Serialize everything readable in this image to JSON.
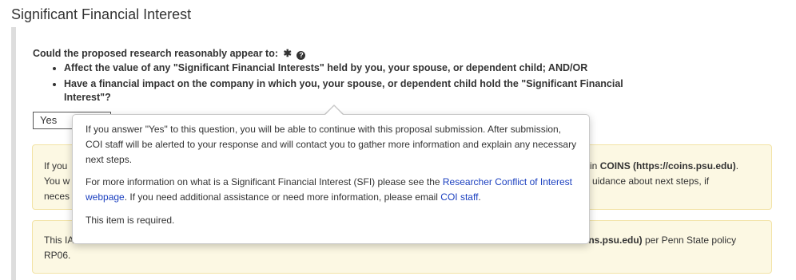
{
  "section": {
    "title": "Significant Financial Interest"
  },
  "question": {
    "label": "Could the proposed research reasonably appear to:",
    "required_icon": "asterisk-icon",
    "help_icon": "question-circle-icon",
    "bullets": [
      "Affect the value of any \"Significant Financial Interests\" held by you, your spouse, or dependent child; AND/OR",
      "Have a financial impact on the company in which you, your spouse, or dependent child hold the \"Significant Financial Interest\"?"
    ]
  },
  "answer_select": {
    "value": "Yes"
  },
  "alert1": {
    "left_line1": "If you",
    "left_line2": "You w",
    "left_line3": "neces",
    "right_prefix": "l in ",
    "right_bold": "COINS (https://coins.psu.edu)",
    "right_suffix": ".",
    "right_line2": "uidance about next steps, if"
  },
  "alert2": {
    "left_line1": "This IA",
    "left_line2": "RP06.",
    "right_bold": "ins.psu.edu)",
    "right_suffix": " per Penn State policy"
  },
  "tooltip": {
    "para1": "If you answer \"Yes\" to this question, you will be able to continue with this proposal submission. After submission, COI staff will be alerted to your response and will contact you to gather more information and explain any necessary next steps.",
    "para2_pre": "For more information on what is a Significant Financial Interest (SFI) please see the ",
    "para2_link1": "Researcher Conflict of Interest webpage",
    "para2_mid": ". If you need additional assistance or need more information, please email ",
    "para2_link2": "COI staff",
    "para2_end": ".",
    "para3": "This item is required."
  },
  "colors": {
    "alert_bg": "#fcf8e3",
    "link": "#1a3fbf"
  }
}
